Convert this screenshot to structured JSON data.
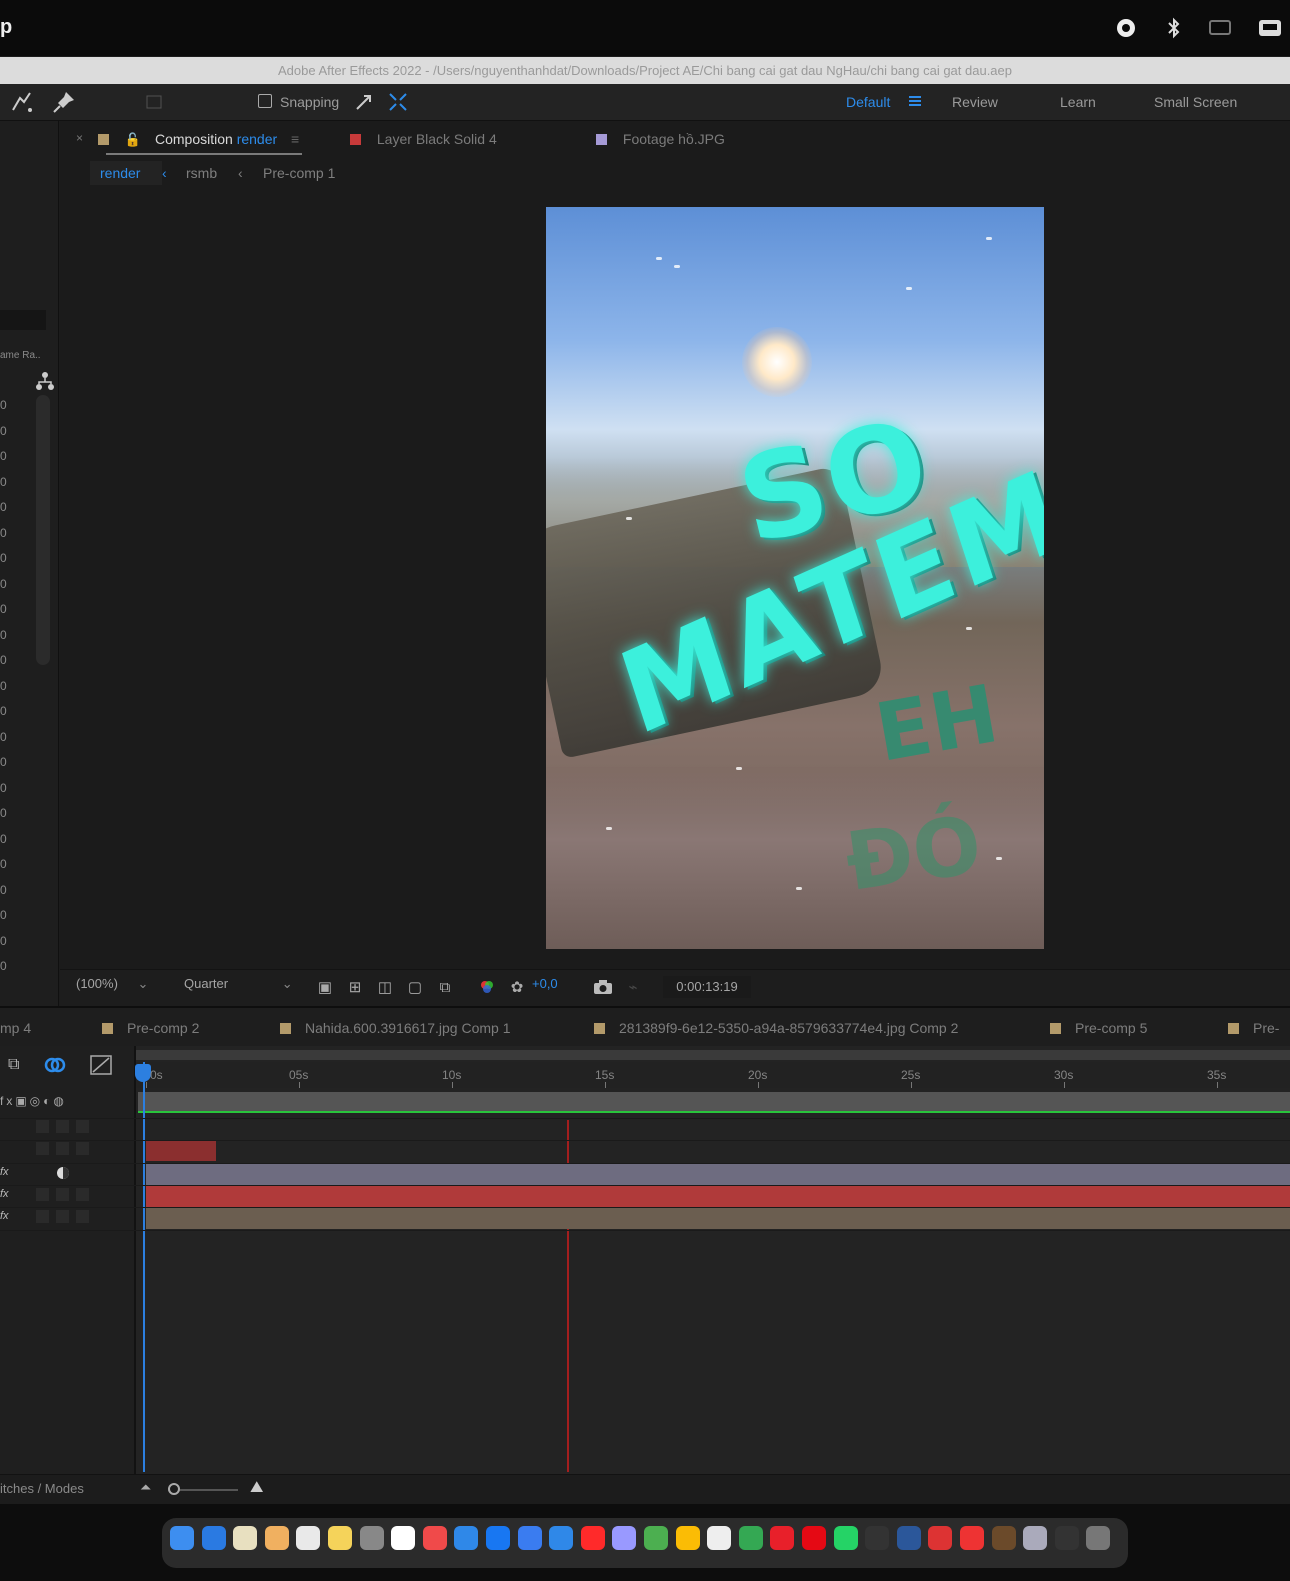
{
  "menubar": {
    "app_name_fragment": "p",
    "icons": [
      "record-icon",
      "bluetooth-icon",
      "screen-mirroring-icon",
      "keyboard-input-icon"
    ]
  },
  "window": {
    "title": "Adobe After Effects 2022 - /Users/nguyenthanhdat/Downloads/Project AE/Chi bang cai gat dau NgHau/chi bang cai gat dau.aep"
  },
  "toolbar": {
    "snapping_label": "Snapping",
    "workspaces": [
      "Default",
      "Review",
      "Learn",
      "Small Screen"
    ],
    "active_workspace": "Default"
  },
  "left_panel": {
    "column_header": "ame Ra..",
    "row_value": "0"
  },
  "comp_panel": {
    "tabs": [
      {
        "prefix": "Composition",
        "name": "render",
        "color": "#b39a6a"
      },
      {
        "prefix": "Layer",
        "name": "Black Solid 4",
        "color": "#c73a3a"
      },
      {
        "prefix": "Footage",
        "name": "hồ.JPG",
        "color": "#a59ad6"
      }
    ],
    "breadcrumbs": [
      "render",
      "rsmb",
      "Pre-comp 1"
    ],
    "viewer_text": [
      "SO",
      "MATEM",
      "EH",
      "ĐÓ"
    ]
  },
  "viewer_bar": {
    "zoom": "(100%)",
    "resolution": "Quarter",
    "exposure": "+0,0",
    "timecode": "0:00:13:19"
  },
  "timeline": {
    "tabs": [
      "mp 4",
      "Pre-comp 2",
      "Nahida.600.3916617.jpg Comp 1",
      "281389f9-6e12-5350-a94a-8579633774e4.jpg Comp 2",
      "Pre-comp 5",
      "Pre-"
    ],
    "ruler_labels": [
      "0s",
      "05s",
      "10s",
      "15s",
      "20s",
      "25s",
      "30s",
      "35s"
    ],
    "tracks": [
      {
        "color": "#8b2f2f"
      },
      {
        "color": "#6e6c80"
      },
      {
        "color": "#b03a3a"
      },
      {
        "color": "#6b5e50"
      }
    ],
    "switches_label": "itches / Modes"
  },
  "dock": {
    "apps": [
      "finder-icon",
      "app-store-icon",
      "notes-icon",
      "photos-icon",
      "launchpad-icon",
      "stickies-icon",
      "settings-icon",
      "calendar-icon",
      "music-icon",
      "mail-icon",
      "facebook-icon",
      "messenger-icon",
      "safari-icon",
      "youtube-icon",
      "after-effects-icon",
      "chrome-icon",
      "google-drive-icon",
      "capcut-icon",
      "maps-icon",
      "acrobat-icon",
      "netflix-icon",
      "whatsapp-icon",
      "chevron-icon",
      "word-icon",
      "mail-m-icon",
      "music-m-icon",
      "folder-icon",
      "screenshot-icon",
      "sketch-icon",
      "trash-icon"
    ]
  }
}
